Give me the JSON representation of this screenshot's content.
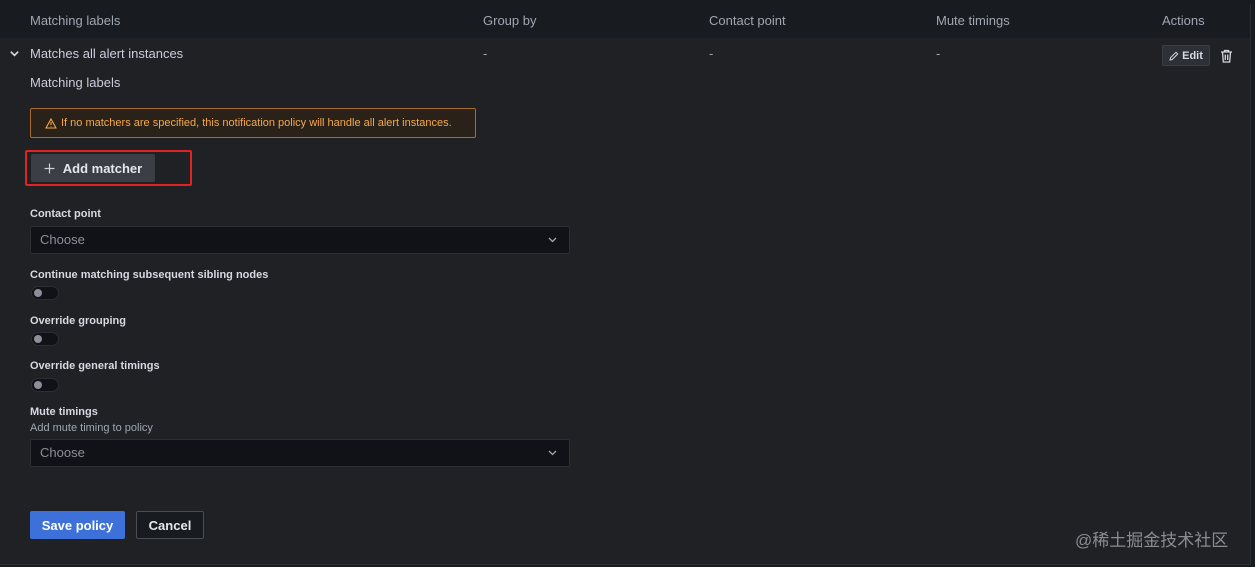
{
  "header": {
    "matching_labels": "Matching labels",
    "group_by": "Group by",
    "contact_point": "Contact point",
    "mute_timings": "Mute timings",
    "actions": "Actions"
  },
  "policy_row": {
    "matching_labels": "Matches all alert instances",
    "group_by": "-",
    "contact_point": "-",
    "mute_timings": "-",
    "edit_label": "Edit"
  },
  "form": {
    "matching_labels_title": "Matching labels",
    "warning_text": "If no matchers are specified, this notification policy will handle all alert instances.",
    "add_matcher_label": "Add matcher",
    "contact_point_label": "Contact point",
    "contact_point_value": "Choose",
    "continue_matching_label": "Continue matching subsequent sibling nodes",
    "override_grouping_label": "Override grouping",
    "override_timings_label": "Override general timings",
    "mute_timings_label": "Mute timings",
    "mute_timings_desc": "Add mute timing to policy",
    "mute_timings_value": "Choose",
    "save_label": "Save policy",
    "cancel_label": "Cancel"
  },
  "toggles": {
    "continue_matching": false,
    "override_grouping": false,
    "override_timings": false
  },
  "colors": {
    "primary": "#3d71d9",
    "warning": "#f5a94f",
    "highlight": "#e02424"
  },
  "watermark": "@稀土掘金技术社区"
}
